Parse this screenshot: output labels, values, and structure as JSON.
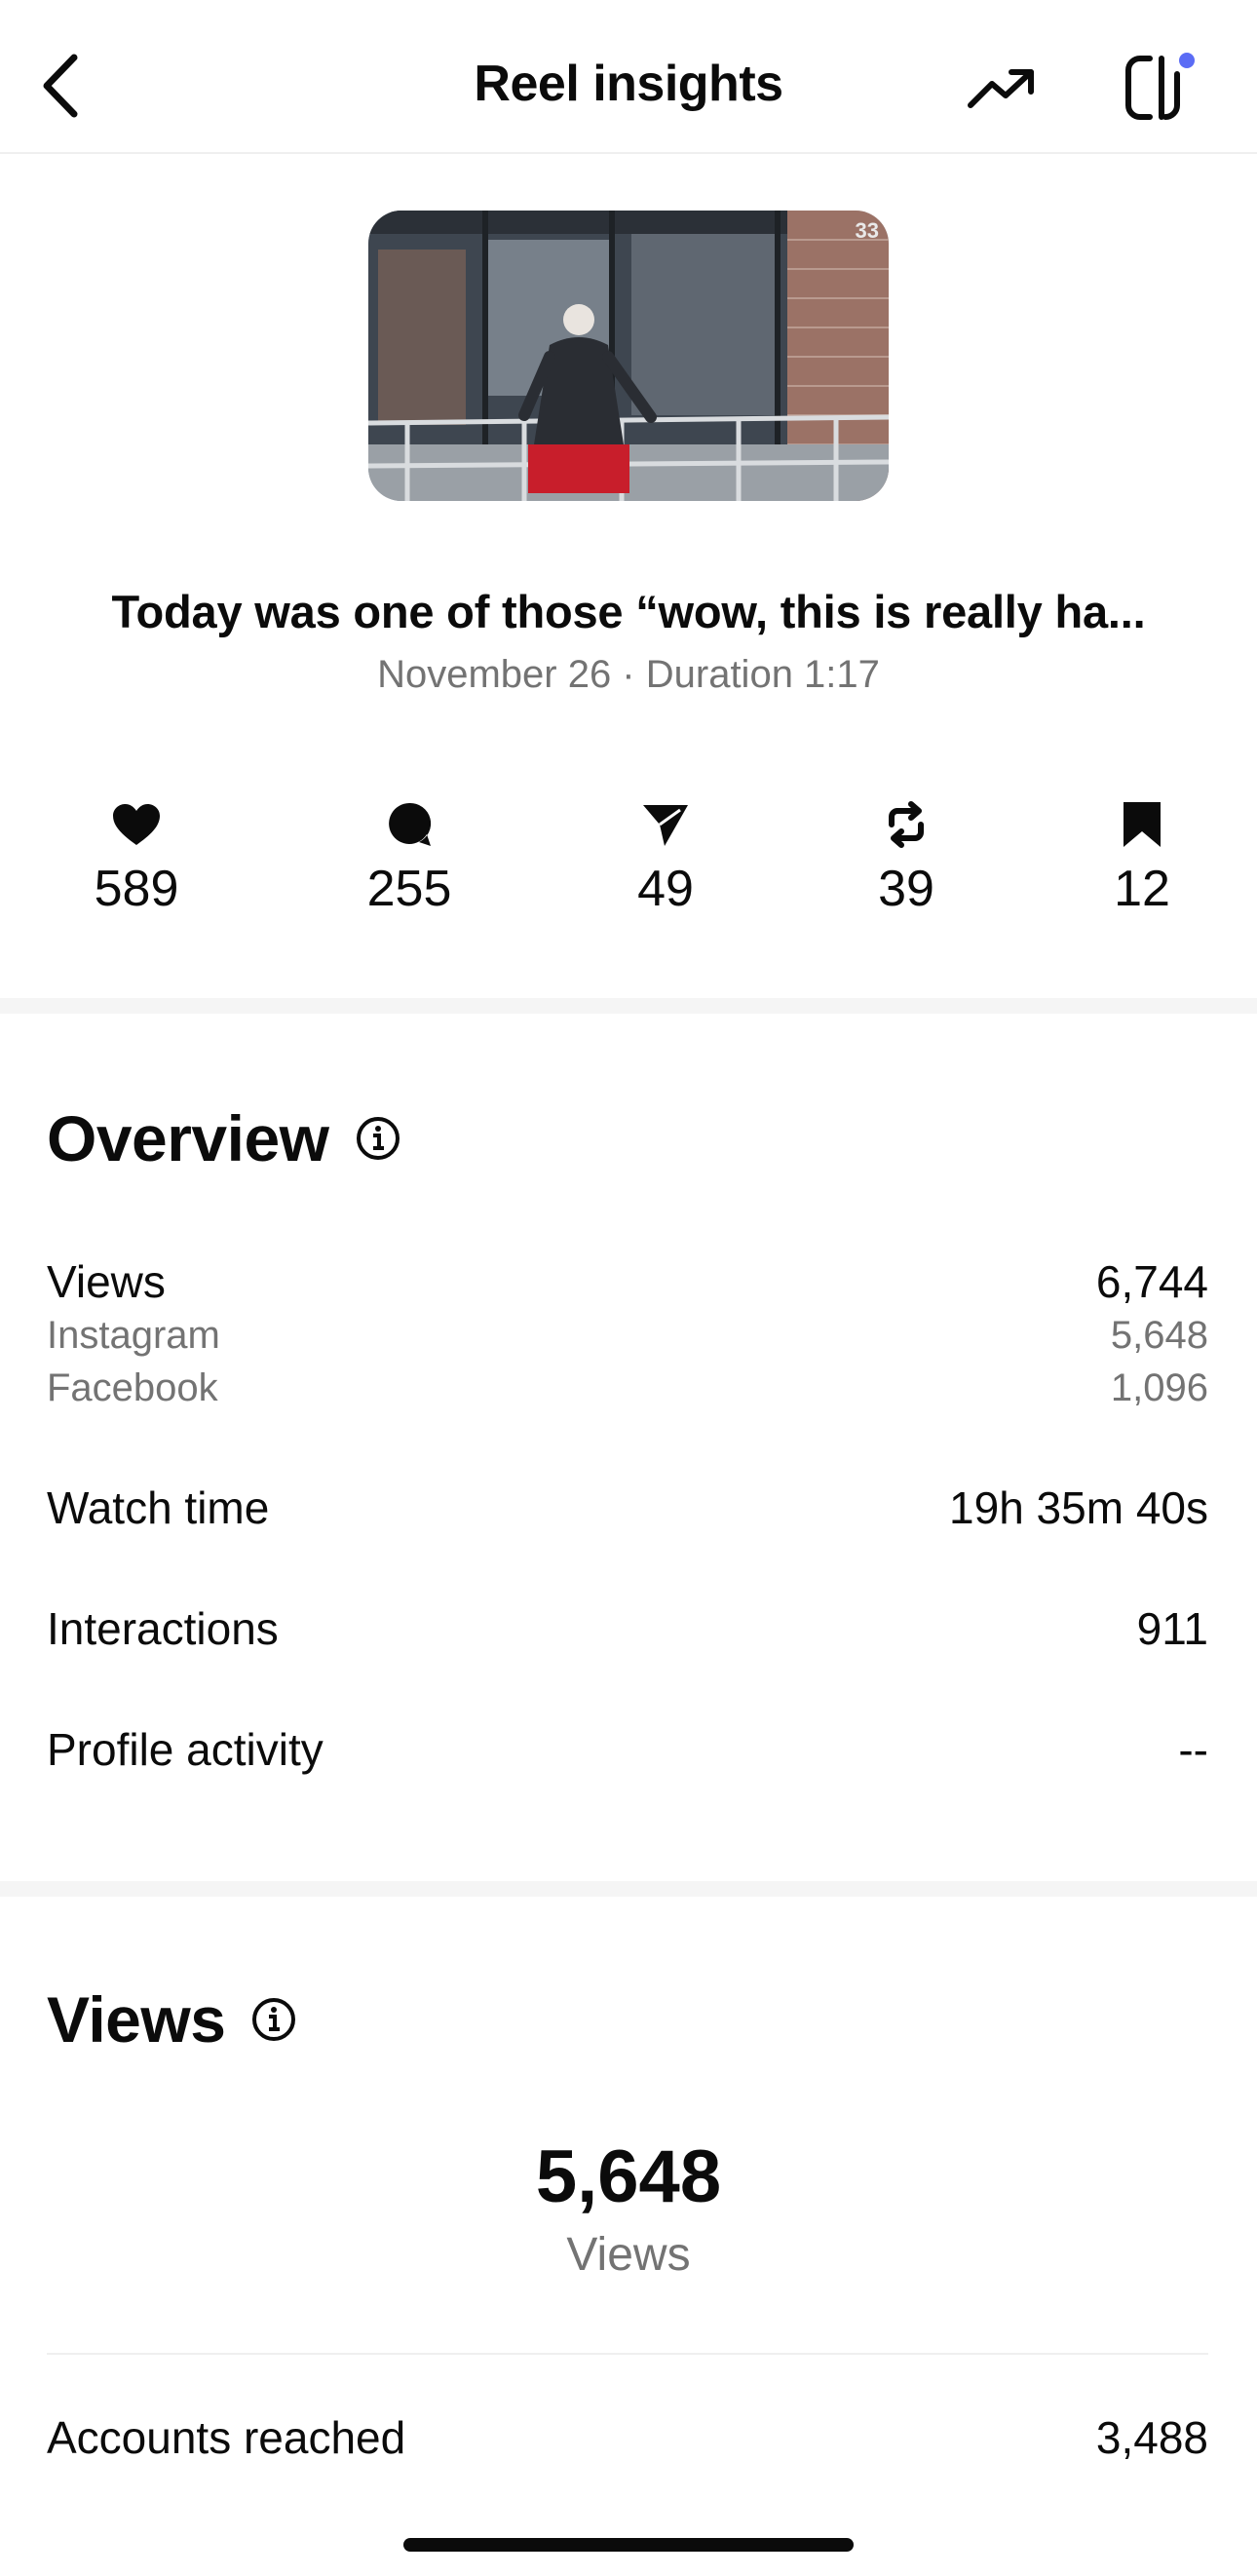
{
  "header": {
    "title": "Reel insights",
    "back_icon": "chevron-left-icon",
    "trend_icon": "trending-up-icon",
    "panel_icon": "side-panel-icon"
  },
  "reel": {
    "thumbnail_counter": "33",
    "caption": "Today was one of those “wow, this is really ha...",
    "meta": "November 26 · Duration 1:17"
  },
  "engagement": [
    {
      "icon": "heart-icon",
      "value": "589"
    },
    {
      "icon": "comment-icon",
      "value": "255"
    },
    {
      "icon": "send-icon",
      "value": "49"
    },
    {
      "icon": "repost-icon",
      "value": "39"
    },
    {
      "icon": "bookmark-icon",
      "value": "12"
    }
  ],
  "overview": {
    "title": "Overview",
    "views_label": "Views",
    "views_value": "6,744",
    "instagram_label": "Instagram",
    "instagram_value": "5,648",
    "facebook_label": "Facebook",
    "facebook_value": "1,096",
    "watch_time_label": "Watch time",
    "watch_time_value": "19h 35m 40s",
    "interactions_label": "Interactions",
    "interactions_value": "911",
    "profile_activity_label": "Profile activity",
    "profile_activity_value": "--"
  },
  "views_section": {
    "title": "Views",
    "total": "5,648",
    "total_label": "Views",
    "accounts_reached_label": "Accounts reached",
    "accounts_reached_value": "3,488"
  },
  "colors": {
    "text_primary": "#0b0b0b",
    "text_secondary": "#737373",
    "notification_dot": "#5b6cf5",
    "divider": "#f5f5f5"
  }
}
